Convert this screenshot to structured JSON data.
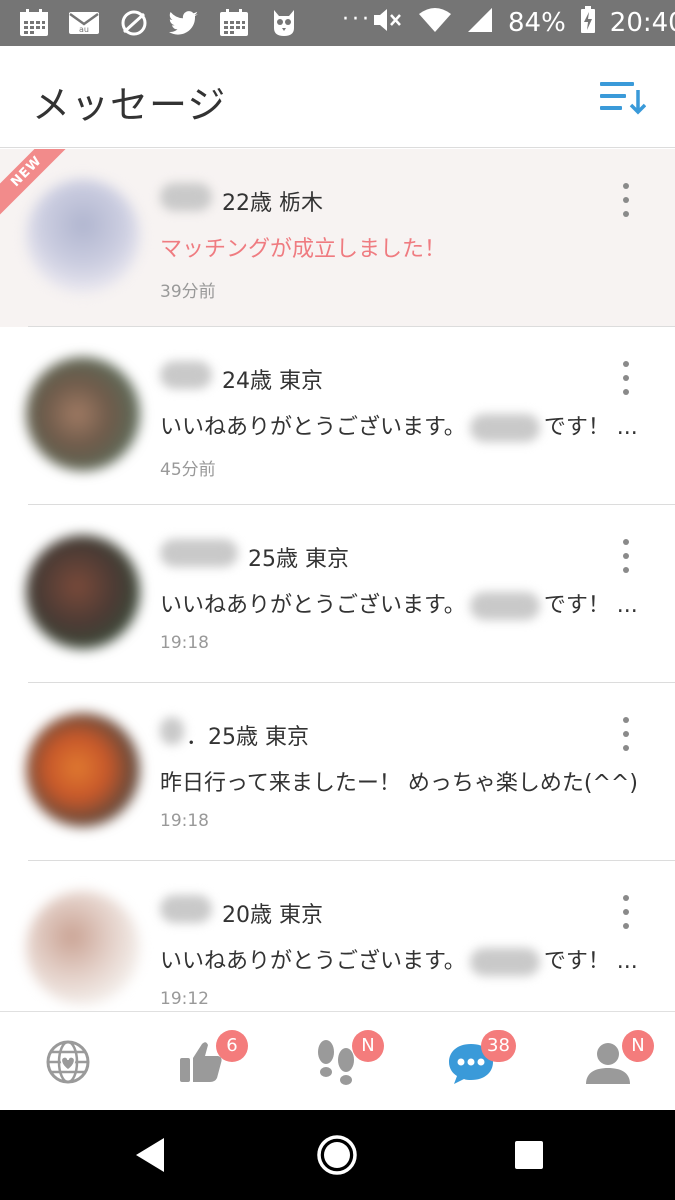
{
  "status_bar": {
    "left_icons": [
      "calendar-icon",
      "mail-icon",
      "sync-icon",
      "twitter-icon",
      "calendar-icon",
      "owl-icon"
    ],
    "overflow": "···",
    "battery": "84%",
    "time": "20:40"
  },
  "header": {
    "title": "メッセージ",
    "sort_icon": "sort-icon",
    "accent": "#3a9ad9"
  },
  "messages": [
    {
      "badge": "NEW",
      "meta": "22歳 栃木",
      "text": "マッチングが成立しました！",
      "text_end": "",
      "time": "39分前",
      "highlight": true
    },
    {
      "meta": "24歳 東京",
      "text": "いいねありがとうございます。",
      "text_end": "です！ ...",
      "time": "45分前"
    },
    {
      "meta": "25歳 東京",
      "text": "いいねありがとうございます。",
      "text_end": "です！ ...",
      "time": "19:18"
    },
    {
      "meta": "．25歳 東京",
      "text": "昨日行って来ましたー！ めっちゃ楽しめた(^^)",
      "text_end": "",
      "time": "19:18"
    },
    {
      "meta": "20歳 東京",
      "text": "いいねありがとうございます。",
      "text_end": "です！ ...",
      "time": "19:12"
    }
  ],
  "bottom_nav": {
    "tabs": [
      {
        "icon": "globe-heart-icon",
        "badge": ""
      },
      {
        "icon": "thumbs-up-icon",
        "badge": "6"
      },
      {
        "icon": "footprints-icon",
        "badge": "N"
      },
      {
        "icon": "chat-bubble-icon",
        "badge": "38"
      },
      {
        "icon": "profile-icon",
        "badge": "N"
      }
    ],
    "badge_color": "#f47c7c"
  },
  "system_nav": [
    "back-icon",
    "home-icon",
    "recents-icon"
  ]
}
